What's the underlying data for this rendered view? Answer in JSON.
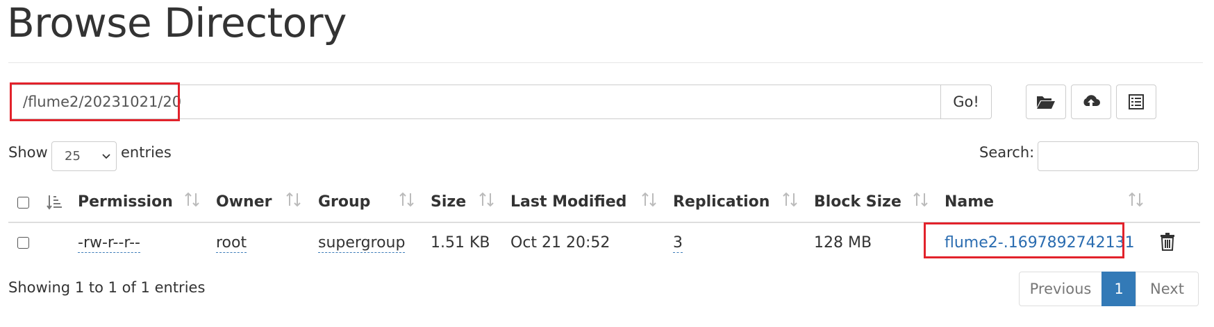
{
  "page": {
    "title": "Browse Directory"
  },
  "path_bar": {
    "path_value": "/flume2/20231021/20",
    "go_label": "Go!"
  },
  "toolbar": {
    "icons": [
      "folder-open-icon",
      "cloud-upload-icon",
      "list-icon"
    ]
  },
  "length_control": {
    "show_label": "Show",
    "selected": "25",
    "entries_label": "entries"
  },
  "search": {
    "label": "Search:",
    "value": ""
  },
  "table": {
    "columns": [
      "Permission",
      "Owner",
      "Group",
      "Size",
      "Last Modified",
      "Replication",
      "Block Size",
      "Name"
    ],
    "rows": [
      {
        "permission": "-rw-r--r--",
        "owner": "root",
        "group": "supergroup",
        "size": "1.51 KB",
        "last_modified": "Oct 21 20:52",
        "replication": "3",
        "block_size": "128 MB",
        "name": "flume2-.1697892742131"
      }
    ]
  },
  "footer": {
    "info": "Showing 1 to 1 of 1 entries",
    "pagination": {
      "previous": "Previous",
      "current": "1",
      "next": "Next"
    }
  },
  "colors": {
    "highlight": "#e2222b",
    "link": "#2a6cb0",
    "active_page": "#337ab7"
  }
}
